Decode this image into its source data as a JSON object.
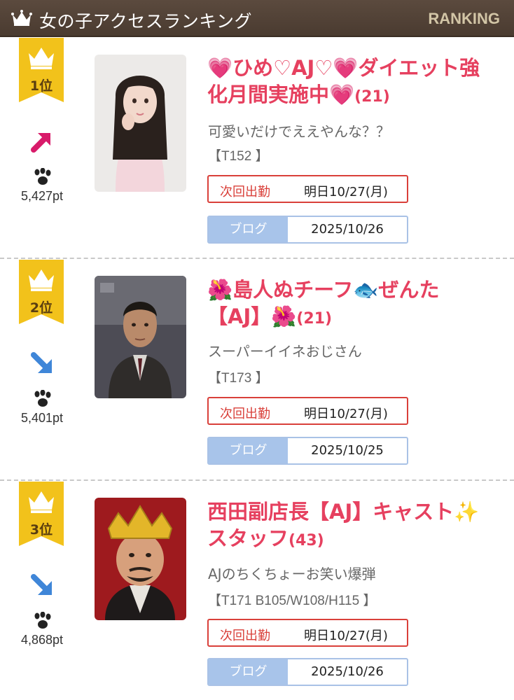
{
  "header": {
    "title": "女の子アクセスランキング",
    "ranking_label": "RANKING"
  },
  "colors": {
    "accent_pink": "#e6405f",
    "header_bg": "#4f4035",
    "gold": "#f2c21b",
    "next_red": "#d9403a",
    "blog_blue": "#a8c4ea"
  },
  "entries": [
    {
      "rank": "1位",
      "trend": "up-right-arrow-icon",
      "points": "5,427pt",
      "name_line1": "💗ひめ♡AJ♡💗ダイエット強",
      "name_line2": "化月間実施中💗",
      "age": "(21)",
      "comment": "可愛いだけでええやんな？？",
      "size": "【T152 】",
      "next_label": "次回出勤",
      "next_value": "明日10/27(月)",
      "blog_label": "ブログ",
      "blog_value": "2025/10/26"
    },
    {
      "rank": "2位",
      "trend": "down-right-arrow-icon",
      "points": "5,401pt",
      "name_line1": "🌺島人ぬチーフ🐟ぜんた",
      "name_line2": "【AJ】🌺",
      "age": "(21)",
      "comment": "スーパーイイネおじさん",
      "size": "【T173 】",
      "next_label": "次回出勤",
      "next_value": "明日10/27(月)",
      "blog_label": "ブログ",
      "blog_value": "2025/10/25"
    },
    {
      "rank": "3位",
      "trend": "down-right-arrow-icon",
      "points": "4,868pt",
      "name_line1": "西田副店長【AJ】キャスト✨",
      "name_line2": "スタッフ",
      "age": "(43)",
      "comment": "AJのちくちょーお笑い爆弾",
      "size": "【T171 B105/W108/H115 】",
      "next_label": "次回出勤",
      "next_value": "明日10/27(月)",
      "blog_label": "ブログ",
      "blog_value": "2025/10/26"
    }
  ]
}
